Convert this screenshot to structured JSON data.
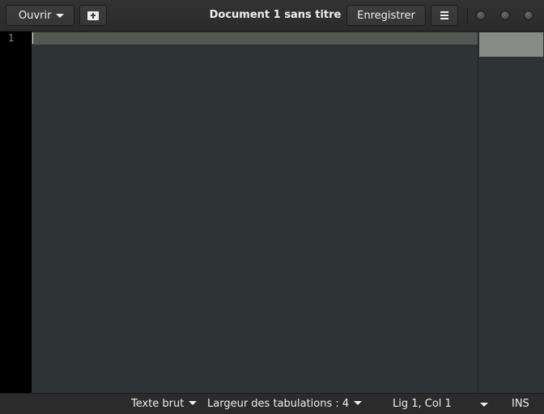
{
  "header": {
    "open_label": "Ouvrir",
    "new_tab_icon": "new-document-icon",
    "title": "Document 1 sans titre",
    "save_label": "Enregistrer",
    "menu_icon": "hamburger-menu-icon",
    "window_buttons": [
      "minimize",
      "maximize",
      "close"
    ]
  },
  "editor": {
    "line_numbers": [
      "1"
    ],
    "content": ""
  },
  "status_bar": {
    "language": "Texte brut",
    "tab_width": "Largeur des tabulations : 4",
    "position": "Lig 1, Col 1",
    "mode": "INS"
  },
  "colors": {
    "background": "#2e3436",
    "gutter": "#000000",
    "current_line": "#555753",
    "header": "#2f2f2f"
  }
}
